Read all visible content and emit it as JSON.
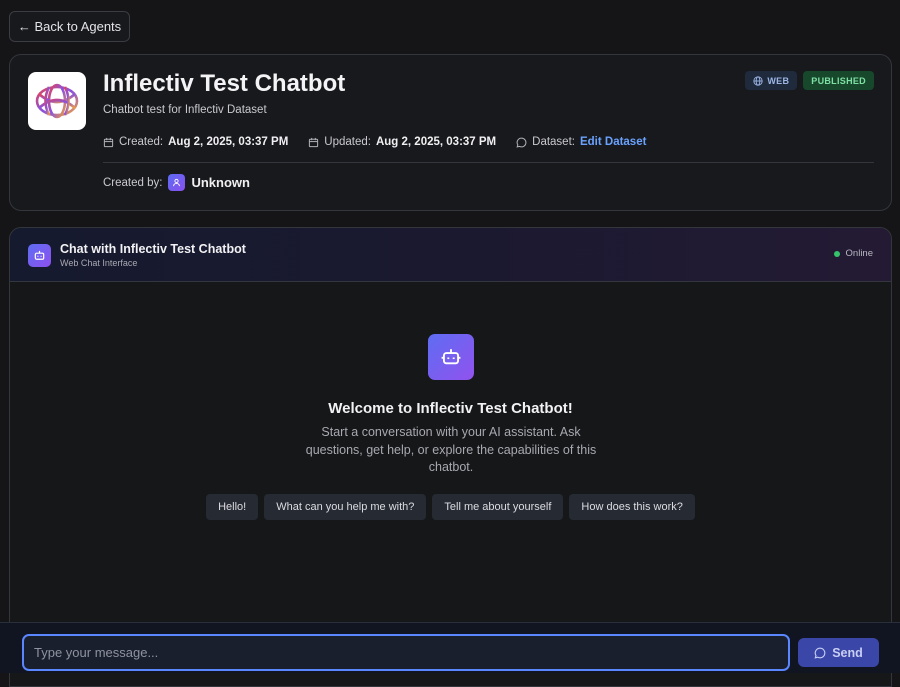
{
  "nav": {
    "back_label": "← Back to Agents"
  },
  "agent": {
    "title": "Inflectiv Test Chatbot",
    "description": "Chatbot test for Inflectiv Dataset",
    "badges": {
      "web": "WEB",
      "status": "PUBLISHED"
    },
    "meta": {
      "created_label": "Created:",
      "created_value": "Aug 2, 2025, 03:37 PM",
      "updated_label": "Updated:",
      "updated_value": "Aug 2, 2025, 03:37 PM",
      "dataset_label": "Dataset:",
      "dataset_link": "Edit Dataset"
    },
    "created_by_label": "Created by:",
    "creator": "Unknown"
  },
  "chat": {
    "title": "Chat with Inflectiv Test Chatbot",
    "subtitle": "Web Chat Interface",
    "status": "Online",
    "welcome_title": "Welcome to Inflectiv Test Chatbot!",
    "welcome_text": "Start a conversation with your AI assistant. Ask questions, get help, or explore the capabilities of this chatbot.",
    "suggestions": [
      "Hello!",
      "What can you help me with?",
      "Tell me about yourself",
      "How does this work?"
    ]
  },
  "composer": {
    "placeholder": "Type your message...",
    "value": "",
    "send_label": "Send"
  },
  "colors": {
    "accent": "#5a86ff",
    "link": "#6aa2ff",
    "published": "#7fe0a3",
    "online": "#35c46a"
  }
}
